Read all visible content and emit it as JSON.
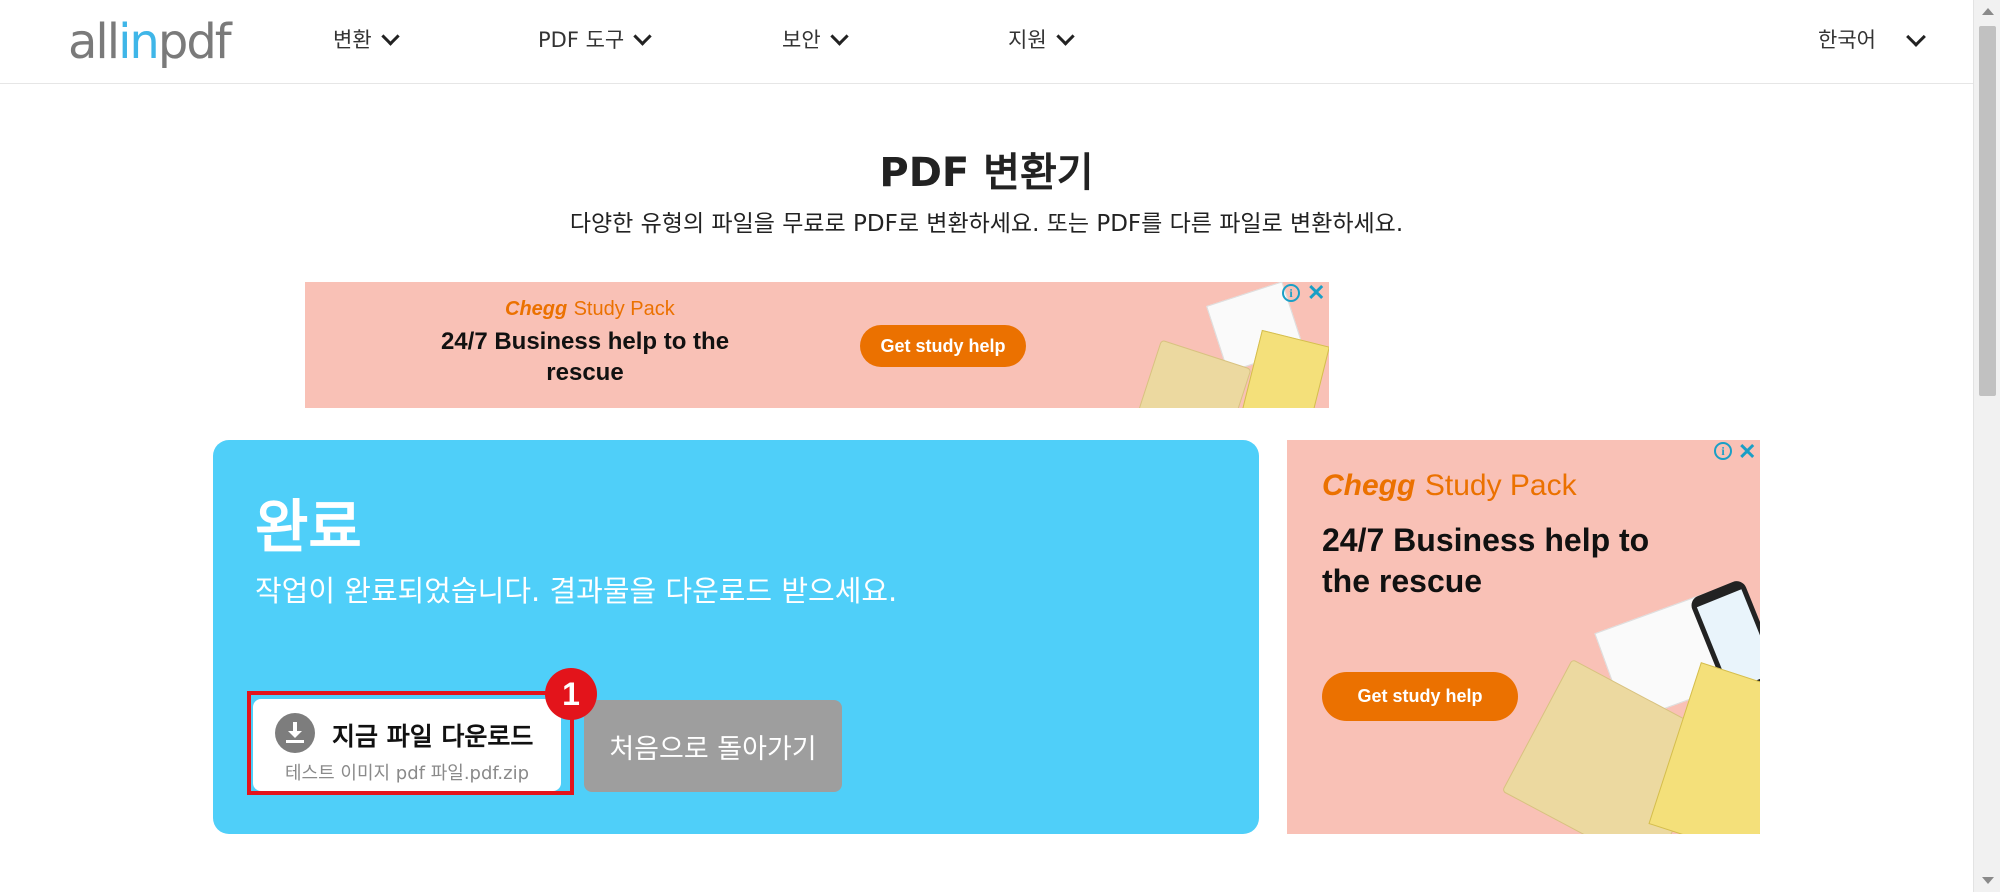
{
  "header": {
    "logo": {
      "part1": "all",
      "part2": "in",
      "part3": "pdf"
    },
    "nav": [
      {
        "label": "변환"
      },
      {
        "label": "PDF 도구"
      },
      {
        "label": "보안"
      },
      {
        "label": "지원"
      }
    ],
    "language": "한국어"
  },
  "hero": {
    "title": "PDF 변환기",
    "subtitle": "다양한 유형의 파일을 무료로 PDF로 변환하세요. 또는 PDF를 다른 파일로 변환하세요."
  },
  "ad_banner": {
    "brand": "Chegg",
    "brand_suffix": "Study Pack",
    "headline": "24/7 Business help to the rescue",
    "cta": "Get study help",
    "info_glyph": "i",
    "close_glyph": "✕"
  },
  "result": {
    "title": "완료",
    "message": "작업이 완료되었습니다. 결과물을 다운로드 받으세요.",
    "download_button": {
      "label": "지금 파일 다운로드",
      "file_name": "테스트 이미지 pdf 파일.pdf.zip",
      "icon": "download-icon"
    },
    "back_button": "처음으로 돌아가기"
  },
  "annotation": {
    "badge": "1",
    "color": "#e3141b"
  },
  "ad_side": {
    "brand": "Chegg",
    "brand_suffix": "Study Pack",
    "headline": "24/7 Business help to the rescue",
    "cta": "Get study help",
    "info_glyph": "i",
    "close_glyph": "✕"
  },
  "colors": {
    "card_bg": "#4fcff9",
    "ad_bg": "#f9c1b6",
    "chegg_orange": "#eb7100",
    "back_button_bg": "#9e9e9e",
    "logo_accent": "#3fb6e8"
  }
}
